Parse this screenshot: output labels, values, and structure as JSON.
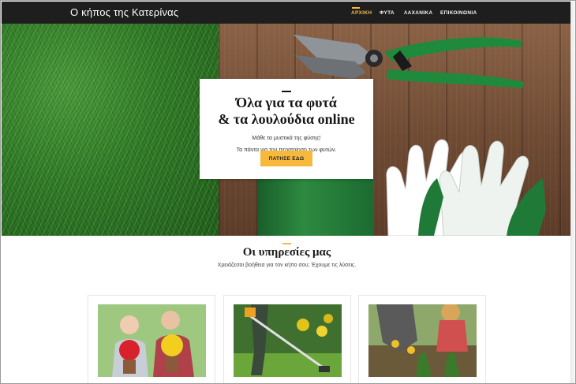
{
  "header": {
    "brand": "Ο κήπος της Κατερίνας",
    "nav": [
      {
        "label": "ΑΡΧΙΚΗ",
        "active": true
      },
      {
        "label": "ΦΥΤΑ",
        "active": false
      },
      {
        "label": "ΛΑΧΑΝΙΚΑ",
        "active": false
      },
      {
        "label": "ΕΠΙΚΟΙΝΩΝΙΑ",
        "active": false
      }
    ]
  },
  "hero": {
    "title_line1": "Όλα για τα φυτά",
    "title_line2": "& τα λουλούδια online",
    "subtitle_line1": "Μάθε τα μυστικά της φύσης!",
    "subtitle_line2": "Τα πάντα για την περιποίηση των φυτών.",
    "cta_label": "ΠΑΤΗΣΕ ΕΔΩ"
  },
  "services": {
    "title": "Οι υπηρεσίες μας",
    "subtitle": "Χρειάζεσαι βοήθεια για τον κήπο σου; Έχουμε τις λύσεις.",
    "cards": [
      {
        "image": "couple-holding-flowers-photo"
      },
      {
        "image": "grass-trimmer-photo"
      },
      {
        "image": "gardeners-planting-photo"
      }
    ]
  },
  "colors": {
    "accent": "#f6b93b",
    "navbar": "#1e1e1e",
    "grass": "#2f7a26",
    "wood": "#6e4a33"
  }
}
